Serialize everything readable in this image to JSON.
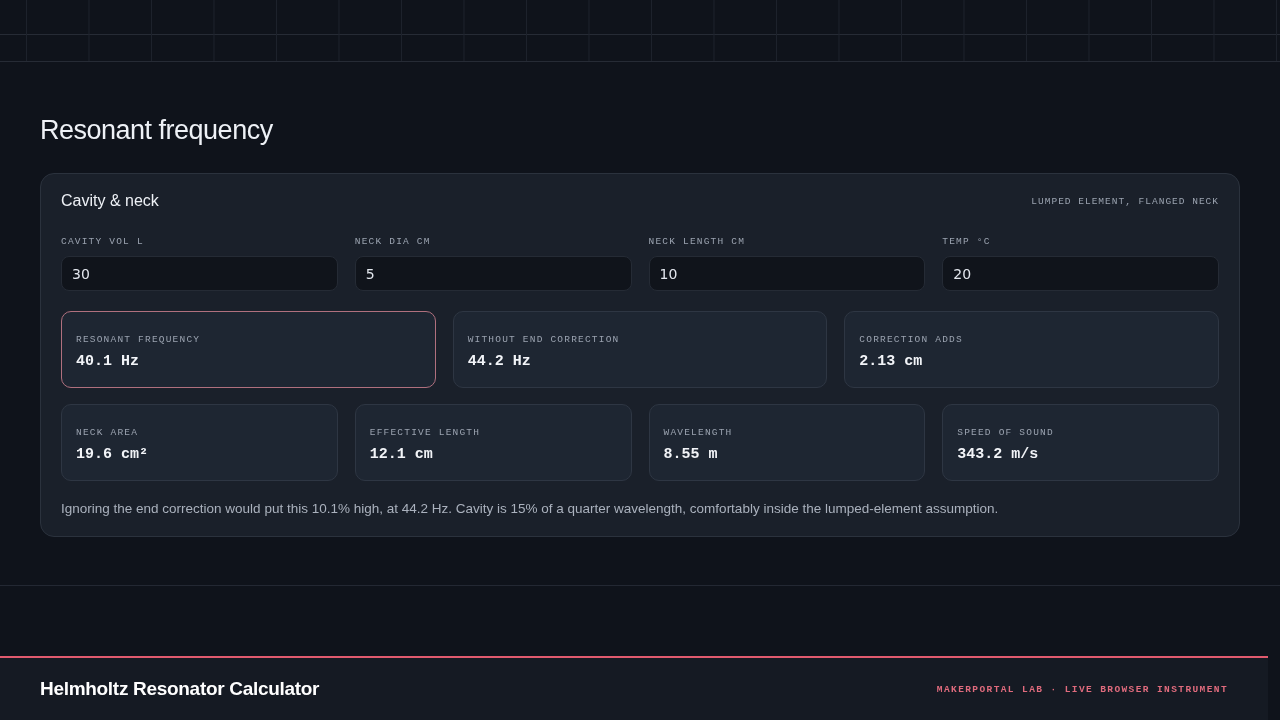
{
  "section": {
    "title": "Resonant frequency"
  },
  "card": {
    "title": "Cavity & neck",
    "note": "LUMPED ELEMENT, FLANGED NECK",
    "inputs": [
      {
        "label": "CAVITY VOL L",
        "value": "30"
      },
      {
        "label": "NECK DIA CM",
        "value": "5"
      },
      {
        "label": "NECK LENGTH CM",
        "value": "10"
      },
      {
        "label": "TEMP °C",
        "value": "20"
      }
    ],
    "results": [
      {
        "label": "RESONANT FREQUENCY",
        "value": "40.1 Hz",
        "highlighted": true
      },
      {
        "label": "WITHOUT END CORRECTION",
        "value": "44.2 Hz",
        "highlighted": false
      },
      {
        "label": "CORRECTION ADDS",
        "value": "2.13 cm",
        "highlighted": false
      }
    ],
    "details": [
      {
        "label": "NECK AREA",
        "value": "19.6 cm²"
      },
      {
        "label": "EFFECTIVE LENGTH",
        "value": "12.1 cm"
      },
      {
        "label": "WAVELENGTH",
        "value": "8.55 m"
      },
      {
        "label": "SPEED OF SOUND",
        "value": "343.2 m/s"
      }
    ],
    "summary": "Ignoring the end correction would put this 10.1% high, at 44.2 Hz. Cavity is 15% of a quarter wavelength, comfortably inside the lumped-element assumption."
  },
  "footer": {
    "title": "Helmholtz Resonator Calculator",
    "tagline": "MAKERPORTAL LAB · LIVE BROWSER INSTRUMENT"
  }
}
